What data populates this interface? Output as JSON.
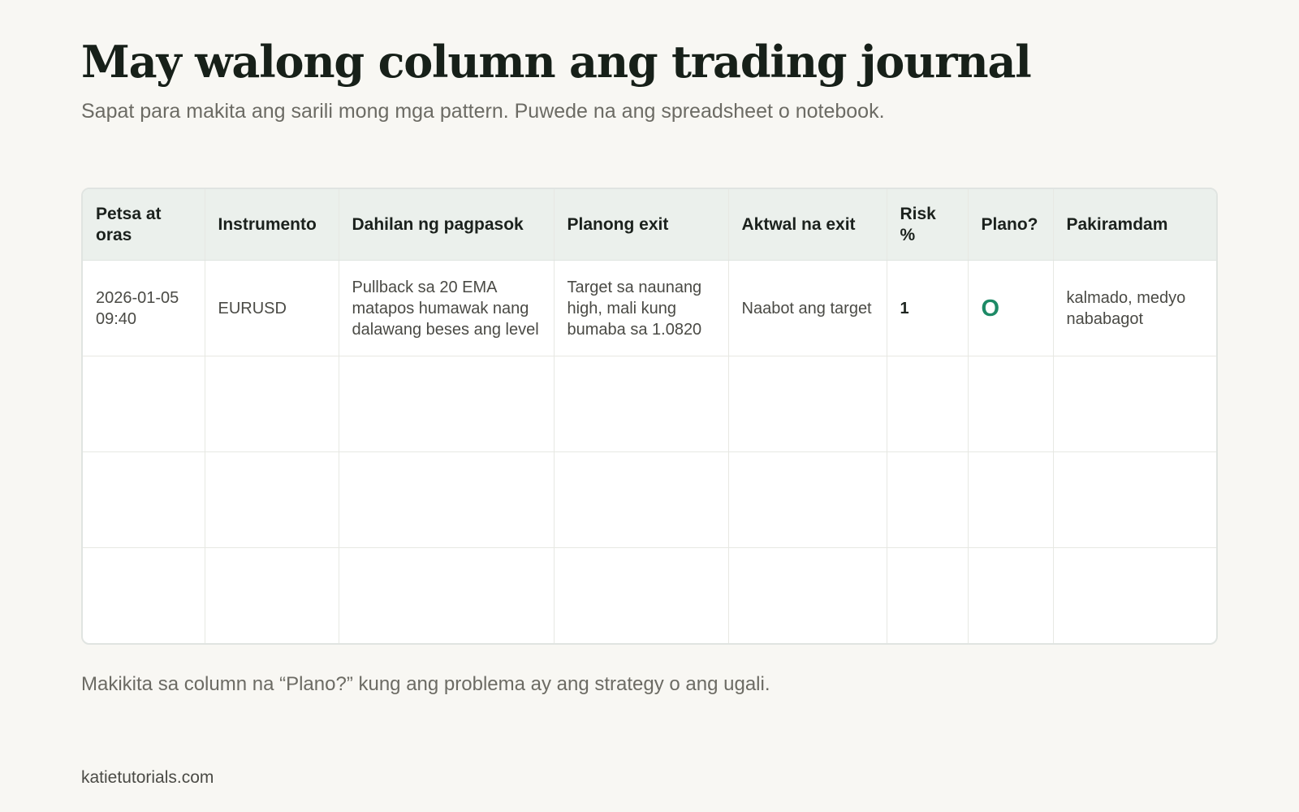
{
  "header": {
    "title": "May walong column ang trading journal",
    "subtitle": "Sapat para makita ang sarili mong mga pattern. Puwede na ang spreadsheet o notebook."
  },
  "table": {
    "columns": [
      "Petsa at oras",
      "Instrumento",
      "Dahilan ng pagpasok",
      "Planong exit",
      "Aktwal na exit",
      "Risk %",
      "Plano?",
      "Pakiramdam"
    ],
    "rows": [
      [
        "2026-01-05 09:40",
        "EURUSD",
        "Pullback sa 20 EMA matapos humawak nang dalawang beses ang level",
        "Target sa naunang high, mali kung bumaba sa 1.0820",
        "Naabot ang target",
        "1",
        "O",
        "kalmado, medyo nababagot"
      ],
      [
        "",
        "",
        "",
        "",
        "",
        "",
        "",
        ""
      ],
      [
        "",
        "",
        "",
        "",
        "",
        "",
        "",
        ""
      ],
      [
        "",
        "",
        "",
        "",
        "",
        "",
        "",
        ""
      ]
    ]
  },
  "note": "Makikita sa column na “Plano?” kung ang problema ay ang strategy o ang ugali.",
  "footer": "katietutorials.com",
  "colors": {
    "background": "#f8f7f3",
    "header_fill": "#ebf0ec",
    "accent_green": "#1d8a66"
  }
}
